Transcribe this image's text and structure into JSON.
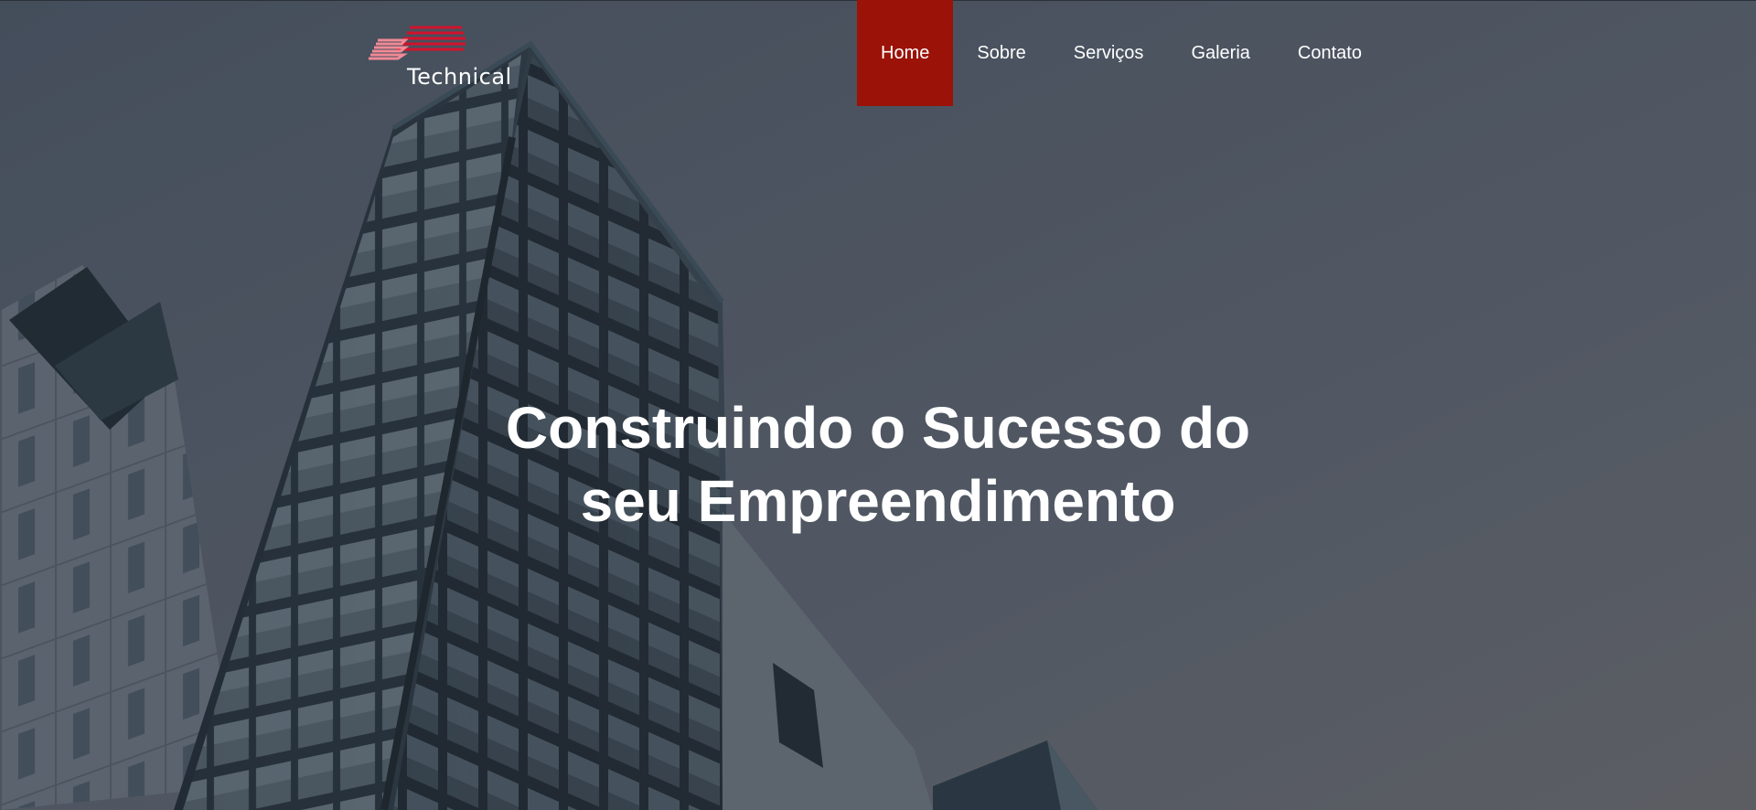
{
  "brand": {
    "name": "Technical",
    "logo_icon": "stacked-red-stripes-logo",
    "accent_color": "#d3122b"
  },
  "nav": {
    "items": [
      {
        "label": "Home",
        "active": true
      },
      {
        "label": "Sobre",
        "active": false
      },
      {
        "label": "Serviços",
        "active": false
      },
      {
        "label": "Galeria",
        "active": false
      },
      {
        "label": "Contato",
        "active": false
      }
    ],
    "active_color": "#9b1208"
  },
  "hero": {
    "headline_line1": "Construindo o Sucesso do",
    "headline_line2": "seu Empreendimento",
    "background": "modern-glass-building-photo"
  }
}
